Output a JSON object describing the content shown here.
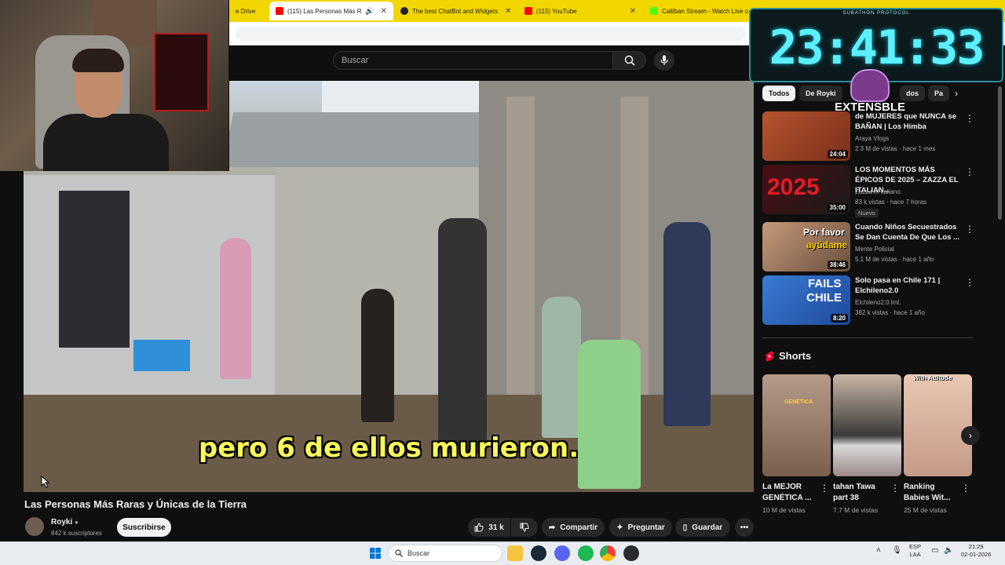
{
  "browser": {
    "tabs": [
      {
        "label": "e Drive",
        "favicon_color": "#1a73e8"
      },
      {
        "label": "(115) Las Personas Más Rar",
        "favicon_color": "#ff0000"
      },
      {
        "label": "The best ChatBot and Widgets",
        "favicon_color": "#202124"
      },
      {
        "label": "(115) YouTube",
        "favicon_color": "#ff0000"
      },
      {
        "label": "Caliiban Stream - Watch Live o",
        "favicon_color": "#53fc18"
      }
    ]
  },
  "youtube": {
    "search_placeholder": "Buscar",
    "video": {
      "subtitle": "pero 6 de ellos murieron.",
      "title": "Las Personas Más Raras y Únicas de la Tierra",
      "channel": "Royki",
      "subscribers": "842 k suscriptores",
      "subscribe_label": "Suscribirse",
      "likes": "31 k",
      "share_label": "Compartir",
      "ask_label": "Preguntar",
      "save_label": "Guardar"
    },
    "chips": [
      "Todos",
      "De Royki",
      "dos",
      "Pa"
    ],
    "recommendations": [
      {
        "title": "de MUJERES que NUNCA se BAÑAN | Los Himba",
        "channel": "Araya Vlogs",
        "meta": "2.3 M de vistas · hace 1 mes",
        "duration": "24:04",
        "badge": ""
      },
      {
        "title": "LOS MOMENTOS MÁS ÉPICOS DE 2025 – ZAZZA EL ITALIAN...",
        "channel": "Zazza el italiano",
        "meta": "83 k vistas · hace 7 horas",
        "duration": "35:00",
        "badge": "Nuevo"
      },
      {
        "title": "Cuando Niños Secuestrados Se Dan Cuenta De Que Los ...",
        "channel": "Mente Policial",
        "meta": "5.1 M de vistas · hace 1 año",
        "duration": "38:46",
        "badge": ""
      },
      {
        "title": "Solo pasa en Chile 171 | Elchileno2.0",
        "channel": "Elchileno2.0 lml.",
        "meta": "382 k vistas · hace 1 año",
        "duration": "8:20",
        "badge": ""
      }
    ],
    "thumb_texts": {
      "rec2": "2025",
      "rec3_line1": "Por favor",
      "rec3_line2": "ayúdame",
      "rec4_line1": "FAILS",
      "rec4_line2": "CHILE"
    },
    "shorts_heading": "Shorts",
    "shorts": [
      {
        "title": "La MEJOR GENÉTICA ...",
        "views": "10 M de vistas",
        "thumb_text": "GENÉTICA"
      },
      {
        "title": "tahan Tawa part 38",
        "views": "7.7 M de vistas",
        "thumb_text": ""
      },
      {
        "title": "Ranking Babies Wit...",
        "views": "25 M de vistas",
        "thumb_text": "With Attitude"
      }
    ]
  },
  "overlay": {
    "timer_label": "SUBATHON PROTOCOL",
    "timer": "23:41:33",
    "extensible": "EXTENSBLE"
  },
  "taskbar": {
    "search_placeholder": "Buscar",
    "lang_line1": "ESP",
    "lang_line2": "LAA",
    "time": "21:29",
    "date": "02-01-2026"
  }
}
